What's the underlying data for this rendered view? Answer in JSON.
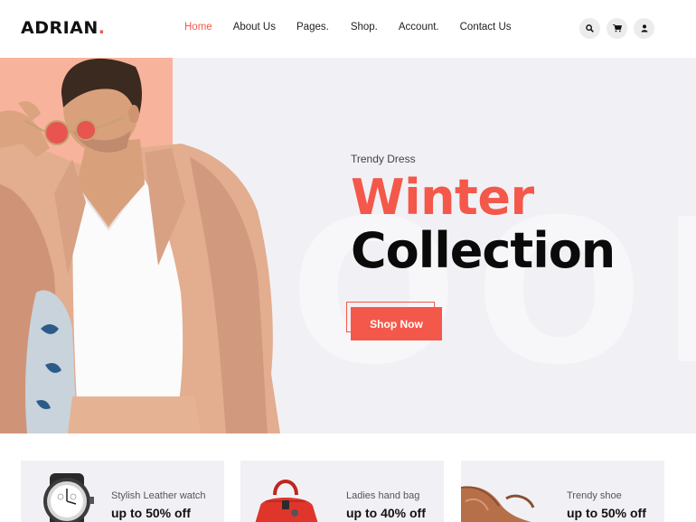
{
  "header": {
    "logo_text": "ADRIAN",
    "logo_dot": ".",
    "nav": [
      {
        "label": "Home",
        "active": true
      },
      {
        "label": "About Us"
      },
      {
        "label": "Pages."
      },
      {
        "label": "Shop."
      },
      {
        "label": "Account."
      },
      {
        "label": "Contact Us"
      }
    ],
    "icons": [
      "search-icon",
      "cart-icon",
      "user-icon"
    ]
  },
  "hero": {
    "subtitle": "Trendy Dress",
    "title_line1": "Winter",
    "title_line2": "Collection",
    "button_label": "Shop Now"
  },
  "products": [
    {
      "title": "Stylish Leather watch",
      "offer": "up to 50% off",
      "icon": "watch-image"
    },
    {
      "title": "Ladies hand bag",
      "offer": "up to 40% off",
      "icon": "handbag-image"
    },
    {
      "title": "Trendy shoe",
      "offer": "up to 50% off",
      "icon": "shoe-image"
    }
  ],
  "colors": {
    "accent": "#f4584a",
    "peach": "#f8b39d",
    "hero_bg": "#f1f1f5"
  }
}
